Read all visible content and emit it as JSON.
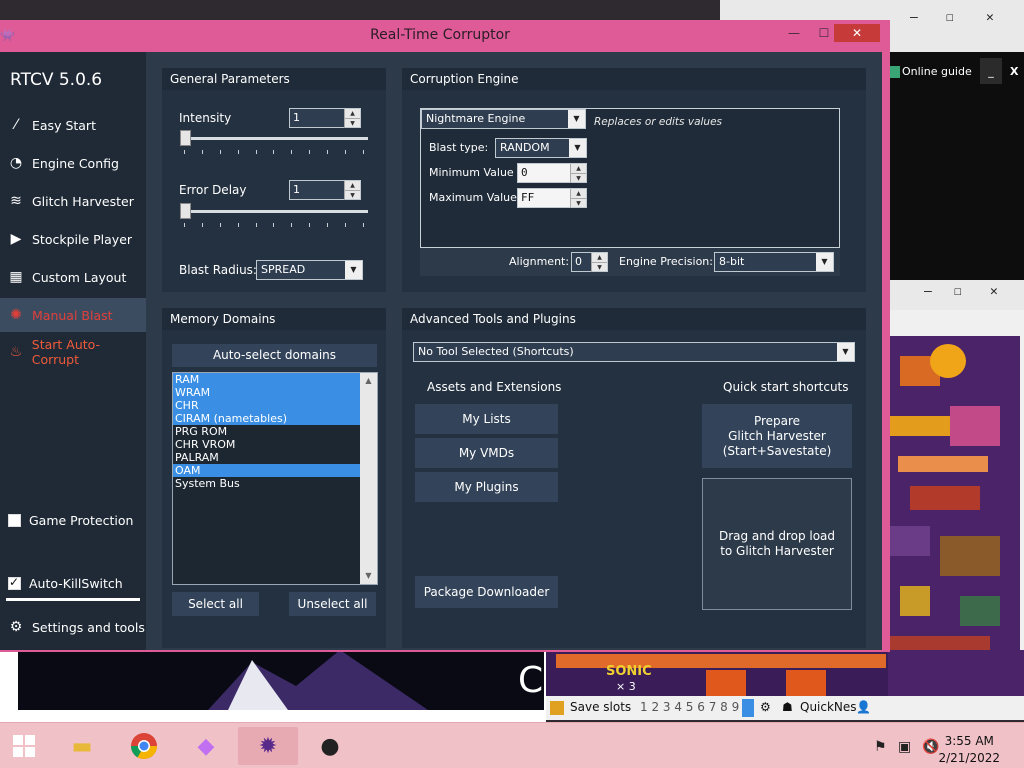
{
  "window": {
    "title": "Real-Time Corruptor",
    "app_name": "RTCV 5.0.6",
    "minimize_glyph": "—",
    "maximize_glyph": "☐",
    "close_glyph": "✕"
  },
  "sidebar": {
    "items": [
      {
        "label": "Easy Start",
        "icon": "wand-icon"
      },
      {
        "label": "Engine Config",
        "icon": "gauge-icon"
      },
      {
        "label": "Glitch Harvester",
        "icon": "layers-icon"
      },
      {
        "label": "Stockpile Player",
        "icon": "play-icon"
      },
      {
        "label": "Custom Layout",
        "icon": "grid-icon"
      },
      {
        "label": "Manual Blast",
        "icon": "blast-icon"
      },
      {
        "label": "Start Auto-Corrupt",
        "icon": "flame-icon"
      }
    ],
    "game_protection": {
      "label": "Game Protection",
      "checked": false
    },
    "auto_killswitch": {
      "label": "Auto-KillSwitch",
      "checked": true
    },
    "settings": {
      "label": "Settings and tools",
      "icon": "gear-icon"
    }
  },
  "general": {
    "header": "General Parameters",
    "intensity_label": "Intensity",
    "intensity_value": "1",
    "error_delay_label": "Error Delay",
    "error_delay_value": "1",
    "blast_radius_label": "Blast Radius:",
    "blast_radius_value": "SPREAD"
  },
  "engine": {
    "header": "Corruption Engine",
    "engine_value": "Nightmare Engine",
    "engine_note": "Replaces or edits values",
    "blast_type_label": "Blast type:",
    "blast_type_value": "RANDOM",
    "min_label": "Minimum Value",
    "min_value": "0",
    "max_label": "Maximum Value",
    "max_value": "FF",
    "alignment_label": "Alignment:",
    "alignment_value": "0",
    "precision_label": "Engine Precision:",
    "precision_value": "8-bit"
  },
  "memory": {
    "header": "Memory Domains",
    "auto_select": "Auto-select domains",
    "domains": [
      {
        "name": "RAM",
        "selected": true
      },
      {
        "name": "WRAM",
        "selected": true
      },
      {
        "name": "CHR",
        "selected": true
      },
      {
        "name": "CIRAM (nametables)",
        "selected": true
      },
      {
        "name": "PRG ROM",
        "selected": false
      },
      {
        "name": "CHR VROM",
        "selected": false
      },
      {
        "name": "PALRAM",
        "selected": false
      },
      {
        "name": "OAM",
        "selected": true
      },
      {
        "name": "System Bus",
        "selected": false
      }
    ],
    "select_all": "Select all",
    "unselect_all": "Unselect all"
  },
  "advanced": {
    "header": "Advanced Tools and Plugins",
    "tool_combo": "No Tool Selected (Shortcuts)",
    "assets_header": "Assets and Extensions",
    "my_lists": "My Lists",
    "my_vmds": "My VMDs",
    "my_plugins": "My Plugins",
    "package_downloader": "Package Downloader",
    "quick_header": "Quick start shortcuts",
    "prepare_line1": "Prepare",
    "prepare_line2": "Glitch Harvester",
    "prepare_line3": "(Start+Savestate)",
    "drop_line1": "Drag and drop load",
    "drop_line2": "to Glitch Harvester"
  },
  "background": {
    "online_guide": "Online guide",
    "online_min": "_",
    "online_close": "X",
    "save_slots": "Save slots",
    "slot_numbers": "1 2 3 4 5 6 7 8 9",
    "quicknes": "QuickNes",
    "game_sonic": "SONIC",
    "game_lives": "× 3"
  },
  "taskbar": {
    "time": "3:55 AM",
    "date": "2/21/2022"
  },
  "colors": {
    "window_frame": "#df5b98",
    "sidebar": "#1f2a36",
    "client": "#2d3a4a",
    "panel": "#243140",
    "selection": "#3a8fe4",
    "accent_red": "#f05a3a",
    "taskbar": "#f0c2c8"
  }
}
